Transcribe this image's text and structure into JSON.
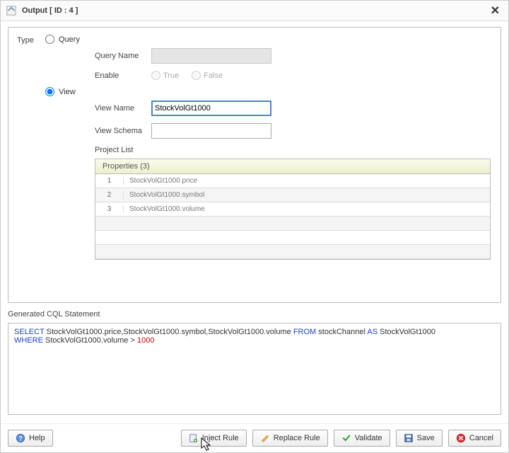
{
  "header": {
    "title": "Output [ ID : 4 ]"
  },
  "type": {
    "label": "Type",
    "options": {
      "query": {
        "label": "Query",
        "selected": false
      },
      "view": {
        "label": "View",
        "selected": true
      }
    }
  },
  "query": {
    "name_label": "Query Name",
    "name_value": "",
    "enable_label": "Enable",
    "true_label": "True",
    "false_label": "False"
  },
  "view": {
    "name_label": "View Name",
    "name_value": "StockVolGt1000",
    "schema_label": "View Schema",
    "schema_value": "",
    "project_list_label": "Project List",
    "grid": {
      "header": "Properties (3)",
      "rows": [
        {
          "idx": "1",
          "value": "StockVolGt1000.price"
        },
        {
          "idx": "2",
          "value": "StockVolGt1000.symbol"
        },
        {
          "idx": "3",
          "value": "StockVolGt1000.volume"
        }
      ]
    }
  },
  "generated": {
    "label": "Generated CQL Statement",
    "tokens": [
      {
        "t": "kw",
        "v": "SELECT"
      },
      {
        "t": "sp",
        "v": " "
      },
      {
        "t": "ident",
        "v": "StockVolGt1000.price,StockVolGt1000.symbol,StockVolGt1000.volume"
      },
      {
        "t": "sp",
        "v": " "
      },
      {
        "t": "kw",
        "v": "FROM"
      },
      {
        "t": "sp",
        "v": " "
      },
      {
        "t": "ident",
        "v": "stockChannel"
      },
      {
        "t": "sp",
        "v": " "
      },
      {
        "t": "kw",
        "v": "AS"
      },
      {
        "t": "sp",
        "v": " "
      },
      {
        "t": "ident",
        "v": "StockVolGt1000"
      },
      {
        "t": "br",
        "v": ""
      },
      {
        "t": "kw",
        "v": "WHERE"
      },
      {
        "t": "sp",
        "v": " "
      },
      {
        "t": "ident",
        "v": "StockVolGt1000.volume >"
      },
      {
        "t": "sp",
        "v": " "
      },
      {
        "t": "num",
        "v": "1000"
      }
    ]
  },
  "buttons": {
    "help": "Help",
    "inject": "Inject Rule",
    "replace": "Replace Rule",
    "validate": "Validate",
    "save": "Save",
    "cancel": "Cancel"
  }
}
